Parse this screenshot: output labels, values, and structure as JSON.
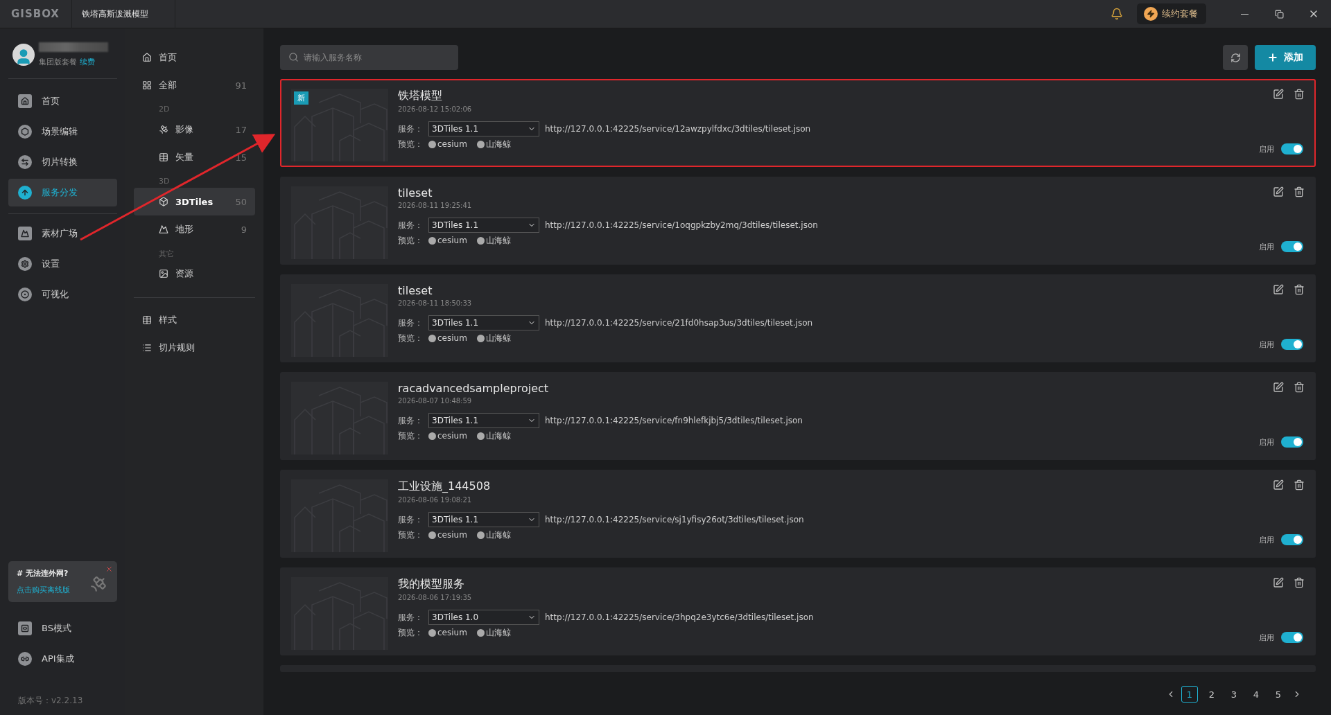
{
  "titlebar": {
    "logo": "GISBOX",
    "tab_title": "铁塔高斯泼溅模型",
    "renew": "续约套餐"
  },
  "user": {
    "plan": "集团版套餐",
    "renew_link": "续费"
  },
  "nav": [
    {
      "label": "首页",
      "selected": false
    },
    {
      "label": "场景编辑",
      "selected": false
    },
    {
      "label": "切片转换",
      "selected": false
    },
    {
      "label": "服务分发",
      "selected": true
    }
  ],
  "nav_more": [
    {
      "label": "素材广场",
      "selected": false
    },
    {
      "label": "设置",
      "selected": false
    },
    {
      "label": "可视化",
      "selected": false
    }
  ],
  "offline_banner": {
    "title": "# 无法连外网?",
    "link": "点击购买离线版"
  },
  "nav_bottom": [
    {
      "label": "BS模式"
    },
    {
      "label": "API集成"
    }
  ],
  "version": "版本号：v2.2.13",
  "categories": {
    "home": "首页",
    "all": {
      "label": "全部",
      "count": "91"
    },
    "groups": [
      {
        "heading": "2D",
        "items": [
          {
            "label": "影像",
            "count": "17",
            "selected": false
          },
          {
            "label": "矢量",
            "count": "15",
            "selected": false
          }
        ]
      },
      {
        "heading": "3D",
        "items": [
          {
            "label": "3DTiles",
            "count": "50",
            "selected": true
          },
          {
            "label": "地形",
            "count": "9",
            "selected": false
          }
        ]
      },
      {
        "heading": "其它",
        "items": [
          {
            "label": "资源",
            "selected": false
          }
        ]
      }
    ],
    "extra": [
      {
        "label": "样式"
      },
      {
        "label": "切片规则"
      }
    ]
  },
  "search": {
    "placeholder": "请输入服务名称"
  },
  "add_button": "添加",
  "services": [
    {
      "title": "铁塔模型",
      "time": "2026-08-12 15:02:06",
      "badge": "新",
      "highlighted": true,
      "service_label": "服务：",
      "version": "3DTiles 1.1",
      "url": "http://127.0.0.1:42225/service/12awzpylfdxc/3dtiles/tileset.json",
      "preview_label": "预览：",
      "previews": [
        "cesium",
        "山海鲸"
      ],
      "enable_label": "启用",
      "enabled": true
    },
    {
      "title": "tileset",
      "time": "2026-08-11 19:25:41",
      "highlighted": false,
      "service_label": "服务：",
      "version": "3DTiles 1.1",
      "url": "http://127.0.0.1:42225/service/1oqgpkzby2mq/3dtiles/tileset.json",
      "preview_label": "预览：",
      "previews": [
        "cesium",
        "山海鲸"
      ],
      "enable_label": "启用",
      "enabled": true
    },
    {
      "title": "tileset",
      "time": "2026-08-11 18:50:33",
      "highlighted": false,
      "service_label": "服务：",
      "version": "3DTiles 1.1",
      "url": "http://127.0.0.1:42225/service/21fd0hsap3us/3dtiles/tileset.json",
      "preview_label": "预览：",
      "previews": [
        "cesium",
        "山海鲸"
      ],
      "enable_label": "启用",
      "enabled": true
    },
    {
      "title": "racadvancedsampleproject",
      "time": "2026-08-07 10:48:59",
      "highlighted": false,
      "service_label": "服务：",
      "version": "3DTiles 1.1",
      "url": "http://127.0.0.1:42225/service/fn9hlefkjbj5/3dtiles/tileset.json",
      "preview_label": "预览：",
      "previews": [
        "cesium",
        "山海鲸"
      ],
      "enable_label": "启用",
      "enabled": true
    },
    {
      "title": "工业设施_144508",
      "time": "2026-08-06 19:08:21",
      "highlighted": false,
      "service_label": "服务：",
      "version": "3DTiles 1.1",
      "url": "http://127.0.0.1:42225/service/sj1yfisy26ot/3dtiles/tileset.json",
      "preview_label": "预览：",
      "previews": [
        "cesium",
        "山海鲸"
      ],
      "enable_label": "启用",
      "enabled": true
    },
    {
      "title": "我的模型服务",
      "time": "2026-08-06 17:19:35",
      "highlighted": false,
      "service_label": "服务：",
      "version": "3DTiles 1.0",
      "url": "http://127.0.0.1:42225/service/3hpq2e3ytc6e/3dtiles/tileset.json",
      "preview_label": "预览：",
      "previews": [
        "cesium",
        "山海鲸"
      ],
      "enable_label": "启用",
      "enabled": true
    }
  ],
  "pagination": [
    {
      "label": "1",
      "selected": true
    },
    {
      "label": "2",
      "selected": false
    },
    {
      "label": "3",
      "selected": false
    },
    {
      "label": "4",
      "selected": false
    },
    {
      "label": "5",
      "selected": false
    }
  ]
}
